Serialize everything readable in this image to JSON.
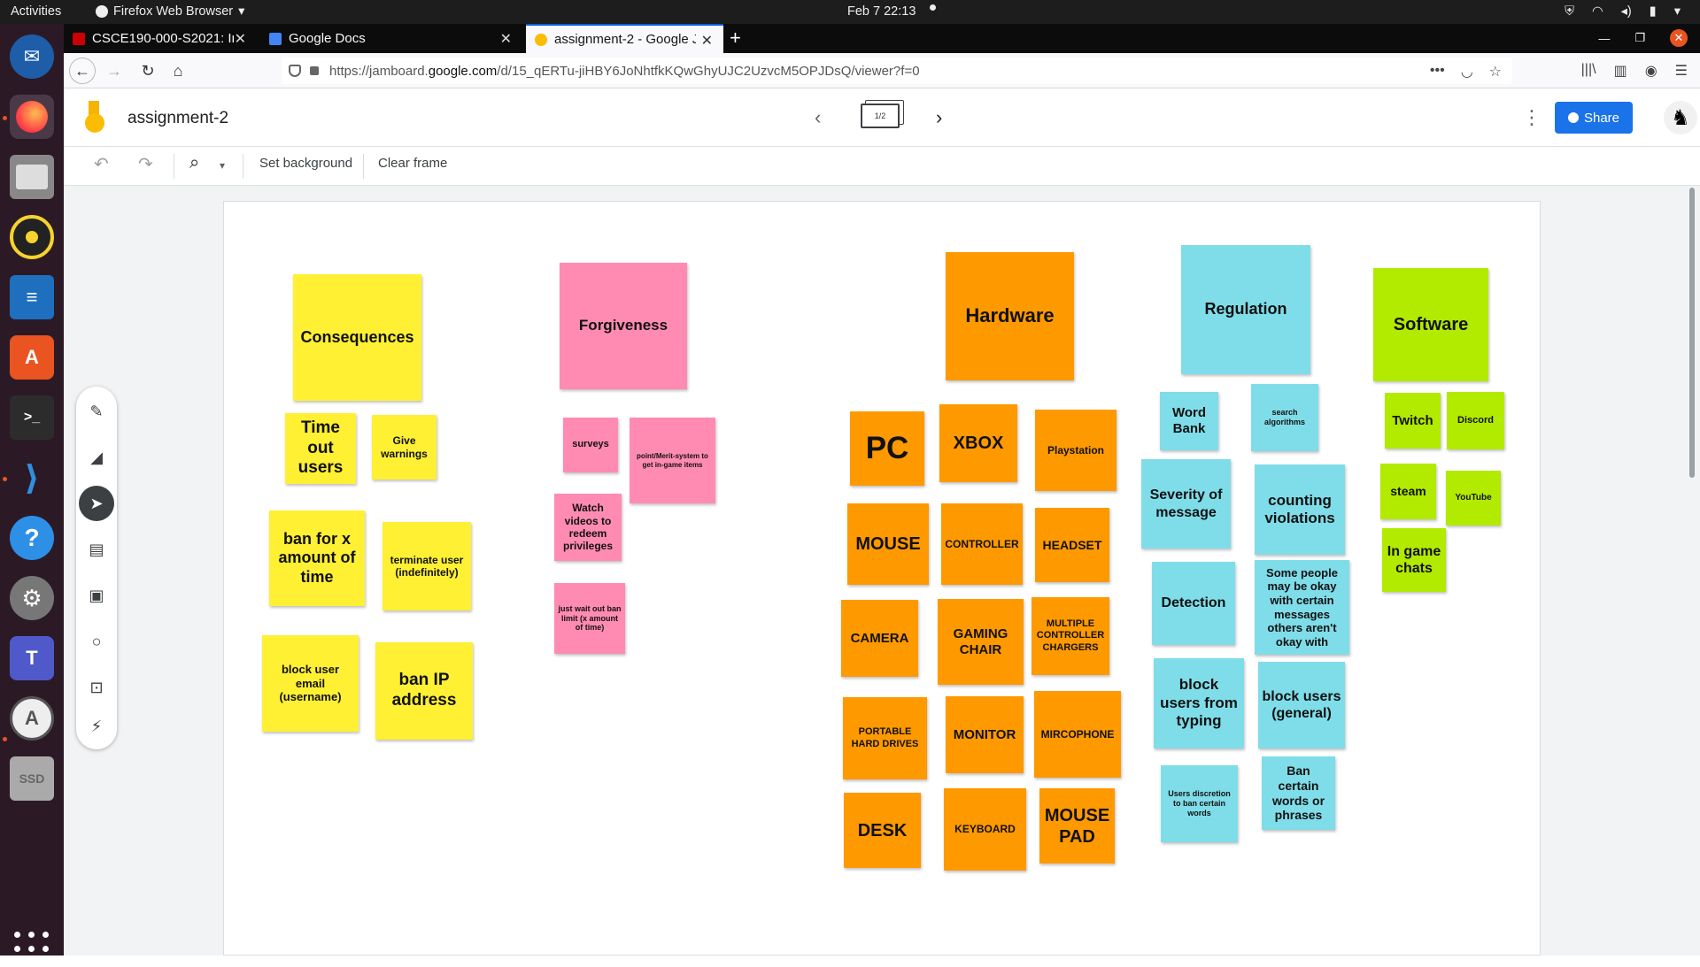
{
  "system_bar": {
    "activities": "Activities",
    "app_name": "Firefox Web Browser",
    "app_menu_arrow": "▾",
    "clock": "Feb 7  22:13"
  },
  "browser": {
    "tabs": [
      {
        "label": "CSCE190-000-S2021: Ind",
        "favicon_color": "#cc0000",
        "active": false
      },
      {
        "label": "Google Docs",
        "favicon_color": "#4285f4",
        "active": false
      },
      {
        "label": "assignment-2 - Google Ja",
        "favicon_color": "#fbbc04",
        "active": true
      }
    ],
    "new_tab": "+",
    "url_prefix": "https://jamboard.",
    "url_domain": "google.com",
    "url_suffix": "/d/15_qERTu-jiHBY6JoNhtfkKQwGhyUJC2UzvcM5OPJDsQ/viewer?f=0"
  },
  "jamboard": {
    "title": "assignment-2",
    "frame_indicator": "1/2",
    "share_label": "Share",
    "toolbar": {
      "set_background": "Set background",
      "clear_frame": "Clear frame"
    }
  },
  "colors": {
    "yellow": "#fff033",
    "pink": "#ff8bb3",
    "orange": "#ff9900",
    "blue": "#7fdde9",
    "green": "#b2ea00",
    "share_button": "#1a73e8"
  },
  "notes": {
    "consequences": "Consequences",
    "time_out": "Time out users",
    "give_warnings": "Give warnings",
    "ban_x_time": "ban for x amount of time",
    "terminate_user": "terminate user (indefinitely)",
    "block_email": "block user email (username)",
    "ban_ip": "ban IP address",
    "forgiveness": "Forgiveness",
    "surveys": "surveys",
    "point_merit": "point/Merit-system to get in-game items",
    "watch_videos": "Watch videos to redeem privileges",
    "wait_out_ban": "just wait out ban limit (x amount of time)",
    "hardware": "Hardware",
    "pc": "PC",
    "xbox": "XBOX",
    "playstation": "Playstation",
    "mouse": "MOUSE",
    "controller": "CONTROLLER",
    "headset": "HEADSET",
    "camera": "CAMERA",
    "gaming_chair": "GAMING CHAIR",
    "multiple_controller_chargers": "MULTIPLE CONTROLLER CHARGERS",
    "portable_hard_drives": "PORTABLE HARD DRIVES",
    "monitor": "MONITOR",
    "mircophone": "MIRCOPHONE",
    "desk": "DESK",
    "keyboard": "KEYBOARD",
    "mouse_pad": "MOUSE PAD",
    "regulation": "Regulation",
    "word_bank": "Word Bank",
    "search_algorithms": "search algorithms",
    "severity_of_message": "Severity of message",
    "counting_violations": "counting violations",
    "detection": "Detection",
    "some_people": "Some people may be okay with certain messages others aren't okay with",
    "block_typing": "block users from typing",
    "block_general": "block users (general)",
    "users_discretion": "Users discretion to ban certain words",
    "ban_words": "Ban certain words or phrases",
    "software": "Software",
    "twitch": "Twitch",
    "discord": "Discord",
    "steam": "steam",
    "youtube": "YouTube",
    "in_game_chats": "In game chats"
  }
}
